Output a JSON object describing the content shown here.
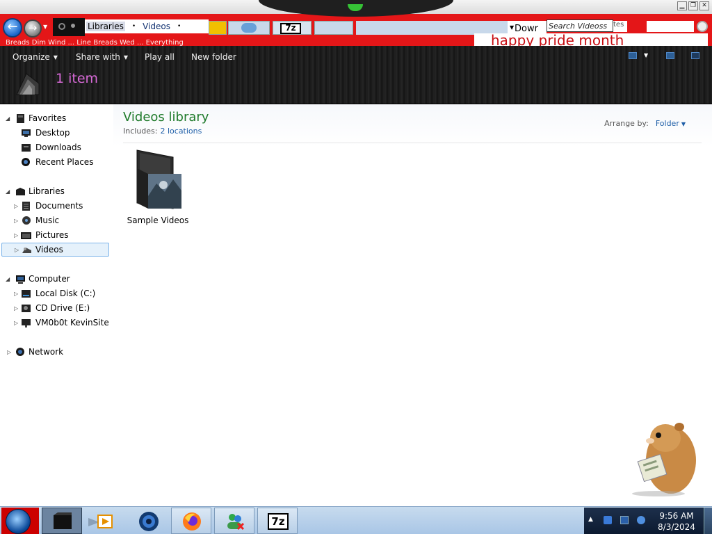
{
  "window": {
    "address_breadcrumbs": [
      "Libraries",
      "Videos"
    ],
    "address_separator": "•",
    "search_placeholder": "Search Videoss",
    "search_tail": "tes",
    "download_label": "Dowr",
    "banner_text": "happy pride month",
    "ticker_text": "Breads Dim Wind ... Line Breads Wed ... Everything",
    "controls": {
      "minimize": "▁",
      "maximize": "❐",
      "close": "✕"
    }
  },
  "toolbar": {
    "organize": "Organize",
    "share_with": "Share with",
    "play_all": "Play all",
    "new_folder": "New folder",
    "item_count": "1 item"
  },
  "nav_pane": {
    "favorites": {
      "label": "Favorites",
      "items": [
        "Desktop",
        "Downloads",
        "Recent Places"
      ]
    },
    "libraries": {
      "label": "Libraries",
      "items": [
        "Documents",
        "Music",
        "Pictures",
        "Videos"
      ]
    },
    "computer": {
      "label": "Computer",
      "items": [
        "Local Disk (C:)",
        "CD Drive (E:)",
        "VM0b0t KevinSite"
      ]
    },
    "network": {
      "label": "Network"
    },
    "selected": "Videos"
  },
  "content": {
    "library_title": "Videos library",
    "includes_label": "Includes:",
    "includes_link": "2 locations",
    "arrange_label": "Arrange by:",
    "arrange_value": "Folder",
    "items": [
      {
        "name": "Sample Videos",
        "type": "folder"
      }
    ]
  },
  "taskbar": {
    "time": "9:56 AM",
    "date": "8/3/2024",
    "tray_expand": "▲",
    "apps": [
      "explorer-icon",
      "media-player-icon",
      "globe-icon",
      "firefox-icon",
      "people-icon",
      "7zip-icon"
    ],
    "seven_zip_label": "7z"
  },
  "colors": {
    "banner_red": "#e41618",
    "library_title_green": "#1e7a2a",
    "item_count_pink": "#d86ad8",
    "link_blue": "#1f5fa8",
    "selection_blue": "#e5f1fb"
  }
}
